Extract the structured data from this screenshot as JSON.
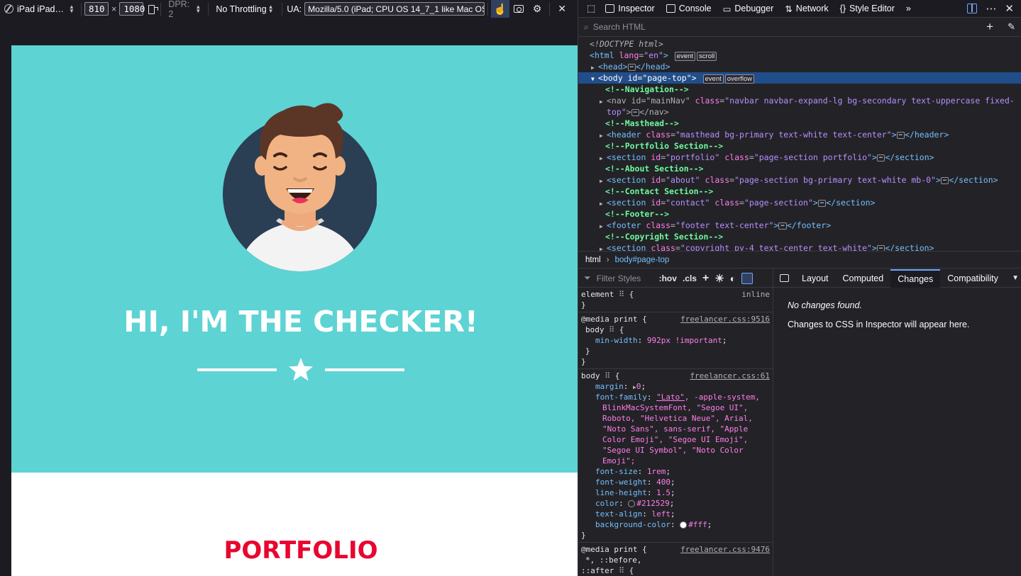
{
  "rdm": {
    "device": "iPad iPad…",
    "width": "810",
    "times": "×",
    "height": "1080",
    "dpr": "DPR: 2",
    "throttling": "No Throttling",
    "ua_label": "UA:",
    "ua_value": "Mozilla/5.0 (iPad; CPU OS 14_7_1 like Mac OS"
  },
  "page": {
    "hero_title": "HI, I'M THE CHECKER!",
    "portfolio_title": "PORTFOLIO",
    "masthead_color": "#5dd3d4",
    "accent_color": "#e8062f"
  },
  "devtools": {
    "tabs": [
      "Inspector",
      "Console",
      "Debugger",
      "Network",
      "Style Editor"
    ],
    "search_placeholder": "Search HTML",
    "breadcrumbs": [
      "html",
      "body#page-top"
    ],
    "filter_placeholder": "Filter Styles",
    "hov": ":hov",
    "cls": ".cls",
    "side_tabs": [
      "Layout",
      "Computed",
      "Changes",
      "Compatibility"
    ],
    "no_changes": "No changes found.",
    "changes_hint": "Changes to CSS in Inspector will appear here.",
    "markup": {
      "doctype": "<!DOCTYPE html>",
      "html_tag": "html",
      "lang_attr": "lang",
      "lang_val": "\"en\"",
      "badge_event": "event",
      "badge_scroll": "scroll",
      "badge_overflow": "overflow",
      "head": "head",
      "body_tag": "body",
      "body_id_attr": "id",
      "body_id_val": "\"page-top\"",
      "c_nav": "<!--Navigation-->",
      "nav_id": "\"mainNav\"",
      "nav_class": "\"navbar navbar-expand-lg bg-secondary text-uppercase fixed-",
      "nav_class2": "top\"",
      "c_masthead": "<!--Masthead-->",
      "header_class": "\"masthead bg-primary text-white text-center\"",
      "c_portfolio": "<!--Portfolio Section-->",
      "portfolio_id": "\"portfolio\"",
      "portfolio_class": "\"page-section portfolio\"",
      "c_about": "<!--About Section-->",
      "about_id": "\"about\"",
      "about_class": "\"page-section bg-primary text-white mb-0\"",
      "c_contact": "<!--Contact Section-->",
      "contact_id": "\"contact\"",
      "contact_class": "\"page-section\"",
      "c_footer": "<!--Footer-->",
      "footer_class": "\"footer text-center\"",
      "c_copyright": "<!--Copyright Section-->",
      "copyright_class": "\"copyright py-4 text-center text-white\""
    },
    "rules": {
      "element_sel": "element",
      "inline": "inline",
      "media1": "@media print {",
      "media1_src": "freelancer.css:9516",
      "media1_sel": "body",
      "minwidth_prop": "min-width",
      "minwidth_val": "992px !important",
      "body_sel": "body",
      "body_src": "freelancer.css:61",
      "margin_prop": "margin",
      "margin_val": "0",
      "ff_prop": "font-family",
      "ff_val_lato": "\"Lato\"",
      "ff_val_1": ", -apple-system,",
      "ff_val_2": "BlinkMacSystemFont, \"Segoe UI\",",
      "ff_val_3": "Roboto, \"Helvetica Neue\", Arial,",
      "ff_val_4": "\"Noto Sans\", sans-serif, \"Apple",
      "ff_val_5": "Color Emoji\", \"Segoe UI Emoji\",",
      "ff_val_6": "\"Segoe UI Symbol\", \"Noto Color",
      "ff_val_7": "Emoji\";",
      "fs_prop": "font-size",
      "fs_val": "1rem",
      "fw_prop": "font-weight",
      "fw_val": "400",
      "lh_prop": "line-height",
      "lh_val": "1.5",
      "color_prop": "color",
      "color_val": "#212529",
      "ta_prop": "text-align",
      "ta_val": "left",
      "bg_prop": "background-color",
      "bg_val": "#fff",
      "media2": "@media print {",
      "media2_src": "freelancer.css:9476",
      "media2_sel1": "*, ::before,",
      "media2_sel2": "::after"
    }
  }
}
